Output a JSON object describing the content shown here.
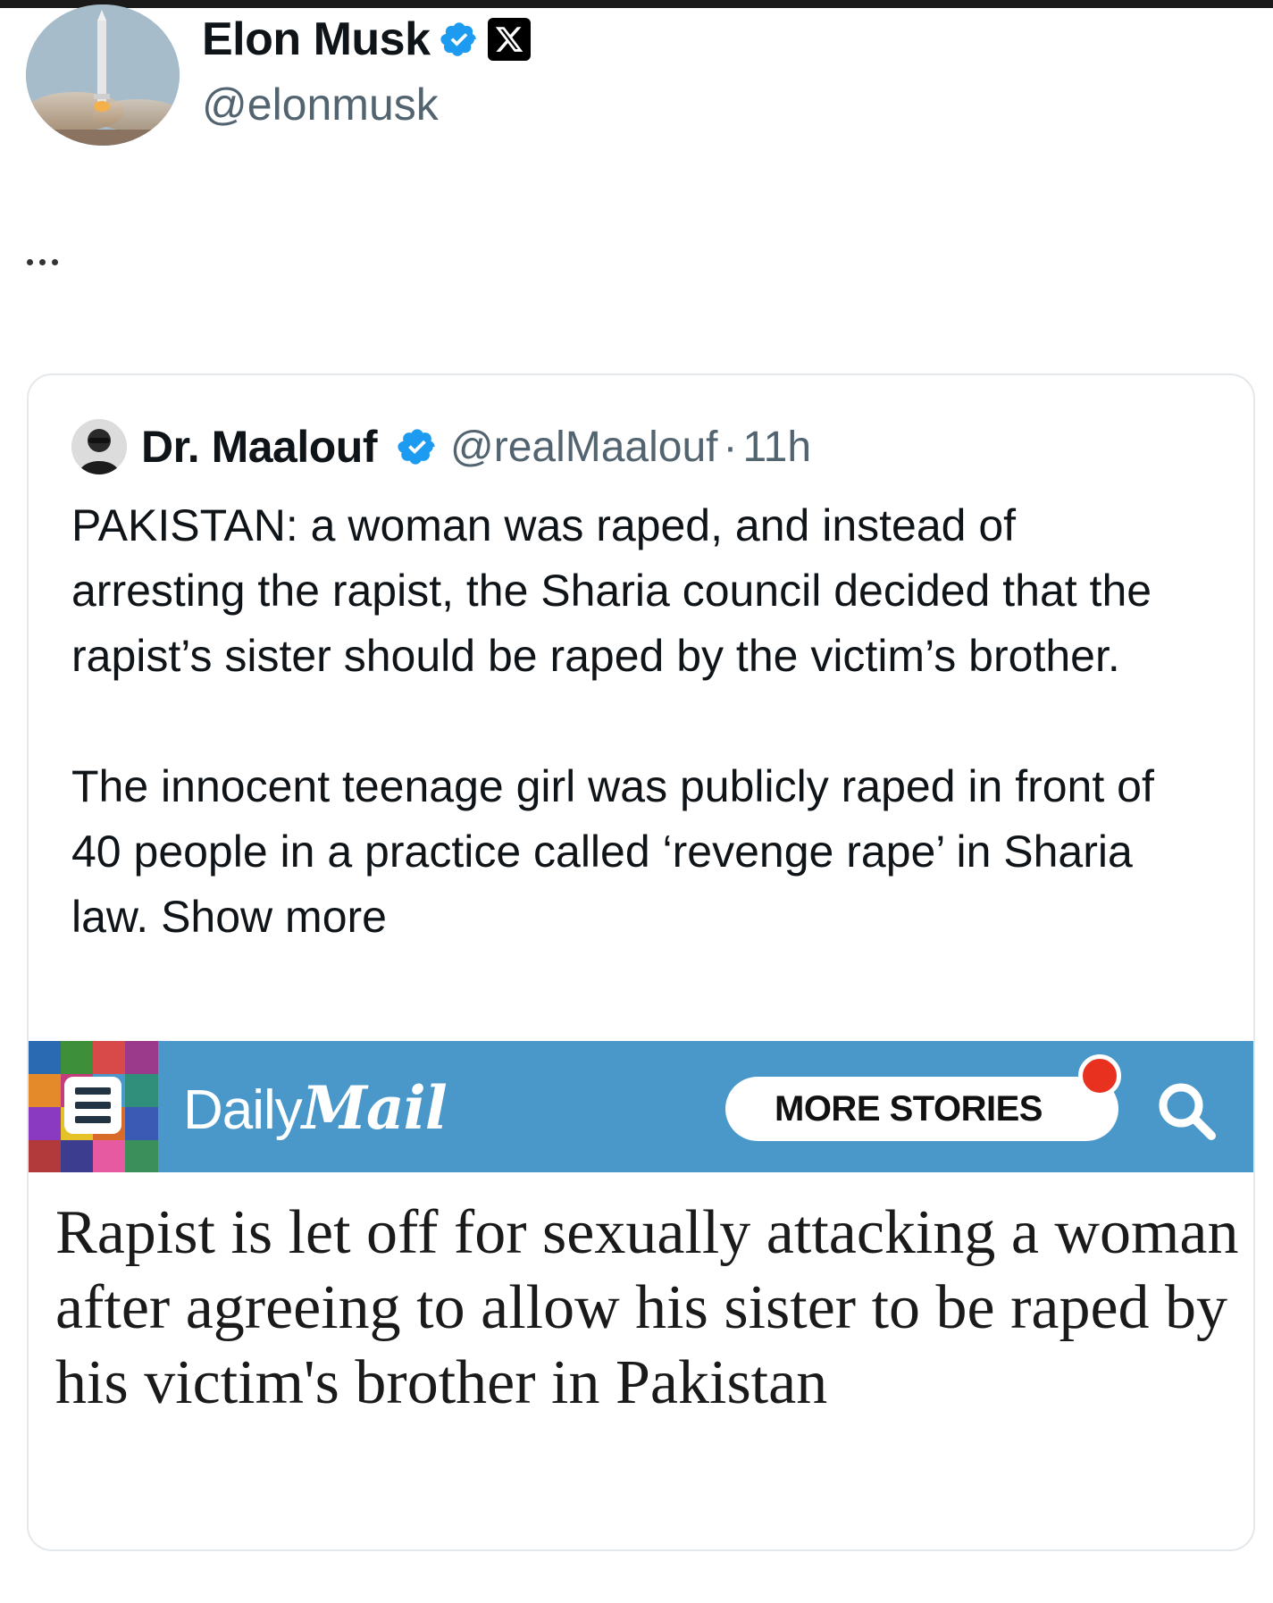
{
  "author": {
    "display_name": "Elon Musk",
    "handle": "@elonmusk",
    "verified": true,
    "badge": "X",
    "avatar": "rocket-launch-avatar"
  },
  "more_menu": "...",
  "quoted_tweet": {
    "author_name": "Dr. Maalouf",
    "handle": "@realMaalouf",
    "separator": "·",
    "time": "11h",
    "verified": true,
    "paragraph_1": "PAKISTAN: a woman was raped, and instead of arresting the rapist, the Sharia council decided that the rapist’s sister should be raped by the victim’s brother.",
    "paragraph_2": "The innocent teenage girl was publicly raped in front of 40 people in a practice called ‘revenge rape’ in Sharia law.",
    "show_more": "Show more"
  },
  "daily_mail": {
    "logo_daily": "Daily",
    "logo_mail": "Mail",
    "more_stories": "MORE STORIES",
    "banner_color": "#4a98c9",
    "headline": "Rapist is let off for sexually attacking a woman after agreeing to allow his sister to be raped by his victim's brother in Pakistan"
  },
  "colors": {
    "verified_blue": "#1d9bf0",
    "secondary_text": "#536471",
    "primary_text": "#0f1419"
  }
}
